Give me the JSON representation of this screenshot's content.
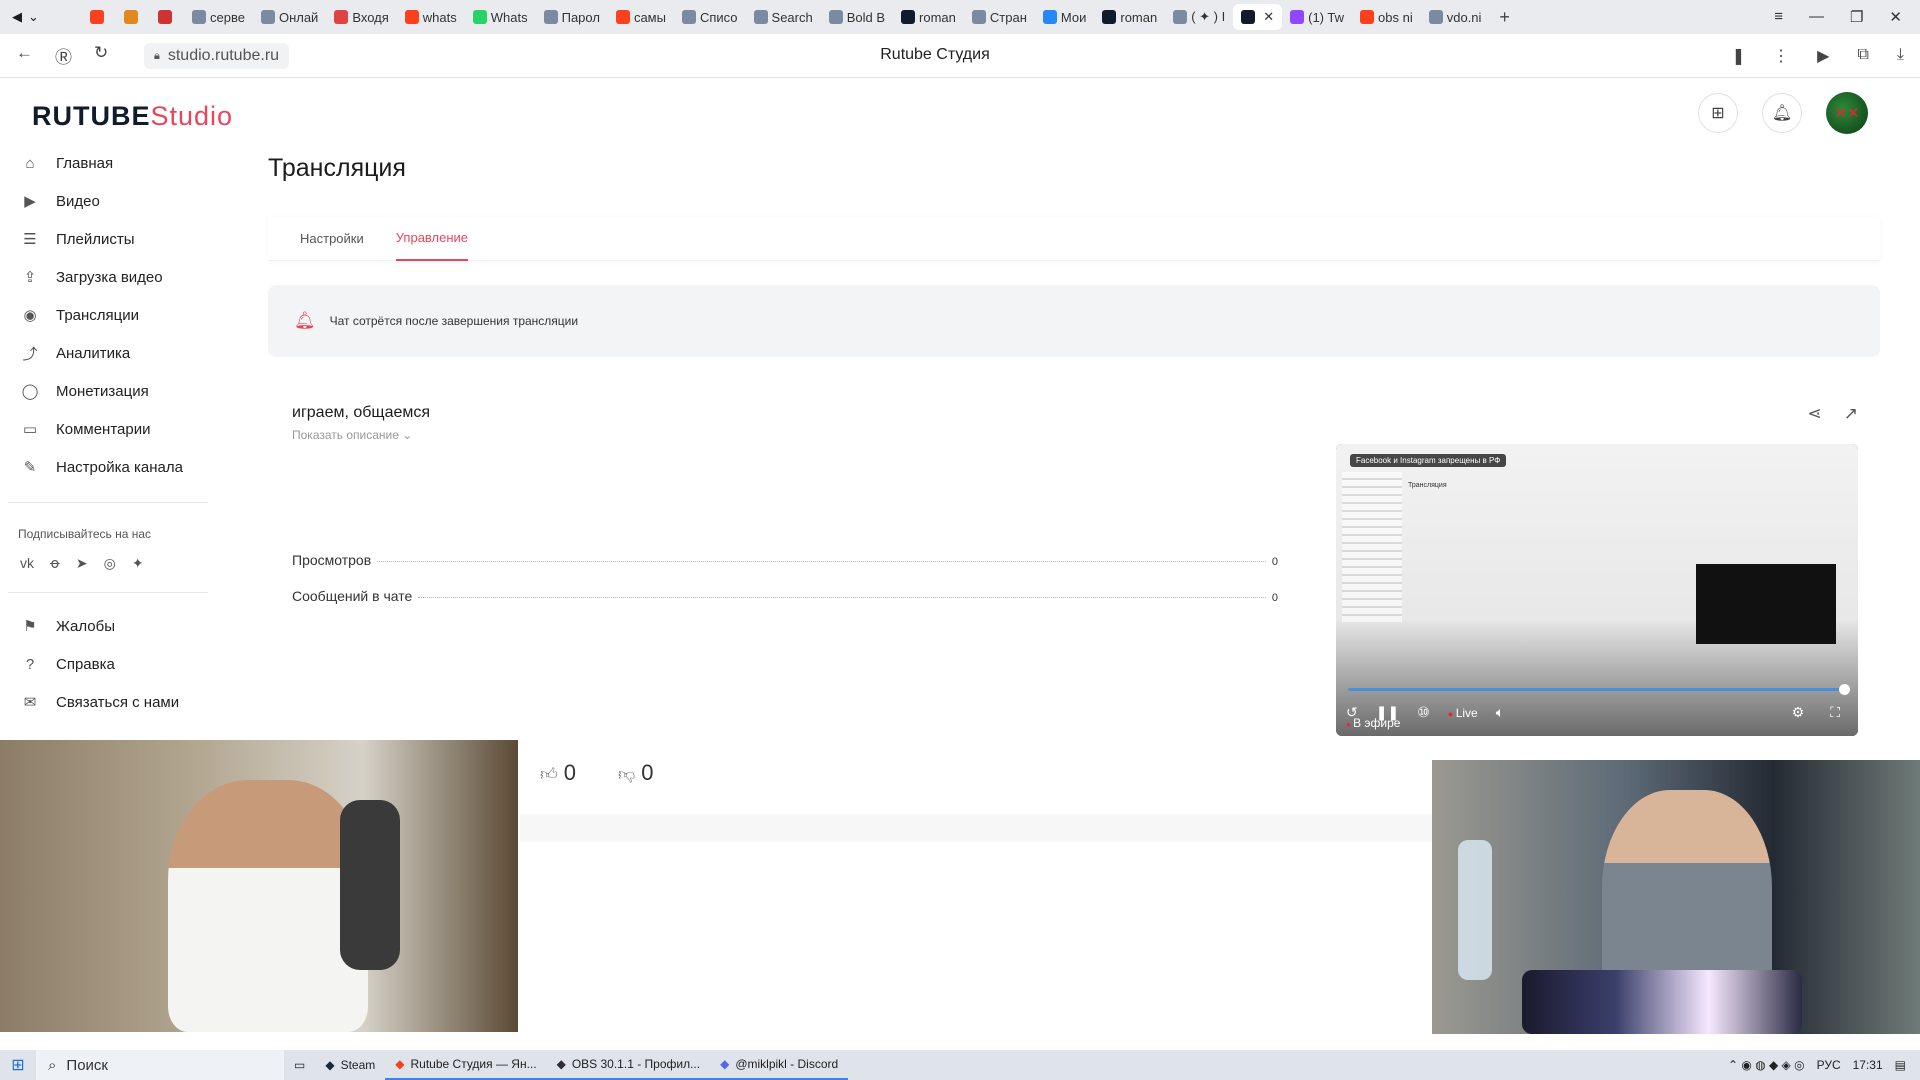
{
  "browser": {
    "tabs": [
      {
        "label": "",
        "icon": "yandex-icon"
      },
      {
        "label": "",
        "icon": "fox-icon"
      },
      {
        "label": "",
        "icon": "five-icon"
      },
      {
        "label": "серве",
        "icon": "app-icon"
      },
      {
        "label": "Онлай",
        "icon": "app-icon"
      },
      {
        "label": "Входя",
        "icon": "gmail-icon"
      },
      {
        "label": "whats",
        "icon": "yandex-icon"
      },
      {
        "label": "Whats",
        "icon": "whatsapp-icon"
      },
      {
        "label": "Парол",
        "icon": "app-icon"
      },
      {
        "label": "самы",
        "icon": "yandex-icon"
      },
      {
        "label": "Списо",
        "icon": "app-icon"
      },
      {
        "label": "Search",
        "icon": "app-icon"
      },
      {
        "label": "Bold B",
        "icon": "app-icon"
      },
      {
        "label": "roman",
        "icon": "rutube-icon"
      },
      {
        "label": "Стран",
        "icon": "app-icon"
      },
      {
        "label": "Мои",
        "icon": "vk-icon"
      },
      {
        "label": "roman",
        "icon": "rutube-icon"
      },
      {
        "label": "( ✦ ) I",
        "icon": "app-icon"
      },
      {
        "label": "",
        "icon": "rutube-icon",
        "active": true
      },
      {
        "label": "(1) Tw",
        "icon": "twitch-icon"
      },
      {
        "label": "obs ni",
        "icon": "yandex-icon"
      },
      {
        "label": "vdo.ni",
        "icon": "app-icon"
      }
    ],
    "url": "studio.rutube.ru",
    "page_title": "Rutube Студия"
  },
  "logo": {
    "brand": "RUTUBE",
    "product": "Studio"
  },
  "sidebar": {
    "items": [
      {
        "label": "Главная",
        "icon": "home-icon"
      },
      {
        "label": "Видео",
        "icon": "video-icon"
      },
      {
        "label": "Плейлисты",
        "icon": "playlist-icon"
      },
      {
        "label": "Загрузка видео",
        "icon": "upload-icon"
      },
      {
        "label": "Трансляции",
        "icon": "broadcast-icon"
      },
      {
        "label": "Аналитика",
        "icon": "analytics-icon"
      },
      {
        "label": "Монетизация",
        "icon": "monetization-icon"
      },
      {
        "label": "Комментарии",
        "icon": "comments-icon"
      },
      {
        "label": "Настройка канала",
        "icon": "channel-settings-icon"
      }
    ],
    "subscribe_label": "Подписывайтесь на нас",
    "bottom_items": [
      {
        "label": "Жалобы",
        "icon": "flag-icon"
      },
      {
        "label": "Справка",
        "icon": "help-icon"
      },
      {
        "label": "Связаться с нами",
        "icon": "contact-icon"
      }
    ]
  },
  "main": {
    "title": "Трансляция",
    "tabs": [
      {
        "label": "Настройки"
      },
      {
        "label": "Управление",
        "active": true
      }
    ],
    "notice": "Чат сотрётся после завершения трансляции",
    "stream": {
      "title": "играем, общаемся",
      "show_description": "Показать описание",
      "stats": [
        {
          "label": "Просмотров",
          "value": "0"
        },
        {
          "label": "Сообщений в чате",
          "value": "0"
        }
      ]
    },
    "player": {
      "banner": "Facebook и Instagram запрещены в РФ",
      "mini_title": "Трансляция",
      "live_label": "Live",
      "on_air_label": "В эфире",
      "progress": 1.0
    },
    "likes": "0",
    "dislikes": "0"
  },
  "taskbar": {
    "search": "Поиск",
    "items": [
      {
        "label": "Steam",
        "open": false
      },
      {
        "label": "Rutube Студия — Ян...",
        "open": true
      },
      {
        "label": "OBS 30.1.1 - Профил...",
        "open": true
      },
      {
        "label": "@miklpikl - Discord",
        "open": true
      }
    ],
    "lang": "РУС",
    "time": "17:31"
  },
  "colors": {
    "accent": "#e8465a",
    "logo_dark": "#101c2c"
  }
}
